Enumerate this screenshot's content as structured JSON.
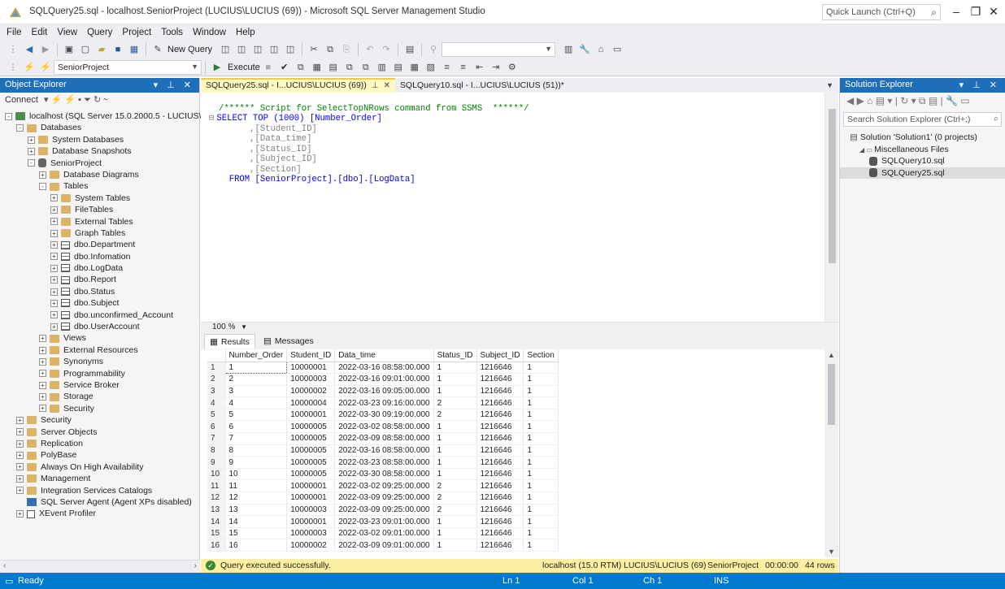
{
  "window": {
    "title": "SQLQuery25.sql - localhost.SeniorProject (LUCIUS\\LUCIUS (69)) - Microsoft SQL Server Management Studio",
    "quick_launch_placeholder": "Quick Launch (Ctrl+Q)"
  },
  "menu": [
    "File",
    "Edit",
    "View",
    "Query",
    "Project",
    "Tools",
    "Window",
    "Help"
  ],
  "toolbar": {
    "new_query": "New Query",
    "database": "SeniorProject",
    "execute": "Execute"
  },
  "object_explorer": {
    "title": "Object Explorer",
    "connect": "Connect",
    "tree": [
      {
        "label": "localhost (SQL Server 15.0.2000.5 - LUCIUS\\LU",
        "level": 0,
        "icon": "server-icon",
        "exp": "-"
      },
      {
        "label": "Databases",
        "level": 1,
        "icon": "folder-icon",
        "exp": "-"
      },
      {
        "label": "System Databases",
        "level": 2,
        "icon": "folder-icon",
        "exp": "+"
      },
      {
        "label": "Database Snapshots",
        "level": 2,
        "icon": "folder-icon",
        "exp": "+"
      },
      {
        "label": "SeniorProject",
        "level": 2,
        "icon": "database-icon",
        "exp": "-"
      },
      {
        "label": "Database Diagrams",
        "level": 3,
        "icon": "folder-icon",
        "exp": "+"
      },
      {
        "label": "Tables",
        "level": 3,
        "icon": "folder-icon",
        "exp": "-"
      },
      {
        "label": "System Tables",
        "level": 4,
        "icon": "folder-icon",
        "exp": "+"
      },
      {
        "label": "FileTables",
        "level": 4,
        "icon": "folder-icon",
        "exp": "+"
      },
      {
        "label": "External Tables",
        "level": 4,
        "icon": "folder-icon",
        "exp": "+"
      },
      {
        "label": "Graph Tables",
        "level": 4,
        "icon": "folder-icon",
        "exp": "+"
      },
      {
        "label": "dbo.Department",
        "level": 4,
        "icon": "table-icon",
        "exp": "+"
      },
      {
        "label": "dbo.Infomation",
        "level": 4,
        "icon": "table-icon",
        "exp": "+"
      },
      {
        "label": "dbo.LogData",
        "level": 4,
        "icon": "table-icon",
        "exp": "+"
      },
      {
        "label": "dbo.Report",
        "level": 4,
        "icon": "table-icon",
        "exp": "+"
      },
      {
        "label": "dbo.Status",
        "level": 4,
        "icon": "table-icon",
        "exp": "+"
      },
      {
        "label": "dbo.Subject",
        "level": 4,
        "icon": "table-icon",
        "exp": "+"
      },
      {
        "label": "dbo.unconfirmed_Account",
        "level": 4,
        "icon": "table-icon",
        "exp": "+"
      },
      {
        "label": "dbo.UserAccount",
        "level": 4,
        "icon": "table-icon",
        "exp": "+"
      },
      {
        "label": "Views",
        "level": 3,
        "icon": "folder-icon",
        "exp": "+"
      },
      {
        "label": "External Resources",
        "level": 3,
        "icon": "folder-icon",
        "exp": "+"
      },
      {
        "label": "Synonyms",
        "level": 3,
        "icon": "folder-icon",
        "exp": "+"
      },
      {
        "label": "Programmability",
        "level": 3,
        "icon": "folder-icon",
        "exp": "+"
      },
      {
        "label": "Service Broker",
        "level": 3,
        "icon": "folder-icon",
        "exp": "+"
      },
      {
        "label": "Storage",
        "level": 3,
        "icon": "folder-icon",
        "exp": "+"
      },
      {
        "label": "Security",
        "level": 3,
        "icon": "folder-icon",
        "exp": "+"
      },
      {
        "label": "Security",
        "level": 1,
        "icon": "folder-icon",
        "exp": "+"
      },
      {
        "label": "Server Objects",
        "level": 1,
        "icon": "folder-icon",
        "exp": "+"
      },
      {
        "label": "Replication",
        "level": 1,
        "icon": "folder-icon",
        "exp": "+"
      },
      {
        "label": "PolyBase",
        "level": 1,
        "icon": "folder-icon",
        "exp": "+"
      },
      {
        "label": "Always On High Availability",
        "level": 1,
        "icon": "folder-icon",
        "exp": "+"
      },
      {
        "label": "Management",
        "level": 1,
        "icon": "folder-icon",
        "exp": "+"
      },
      {
        "label": "Integration Services Catalogs",
        "level": 1,
        "icon": "folder-icon",
        "exp": "+"
      },
      {
        "label": "SQL Server Agent (Agent XPs disabled)",
        "level": 1,
        "icon": "agent-icon",
        "exp": ""
      },
      {
        "label": "XEvent Profiler",
        "level": 1,
        "icon": "xevent-icon",
        "exp": "+"
      }
    ]
  },
  "tabs": [
    {
      "label": "SQLQuery25.sql - I...UCIUS\\LUCIUS (69))",
      "active": true
    },
    {
      "label": "SQLQuery10.sql - I...UCIUS\\LUCIUS (51))*",
      "active": false
    }
  ],
  "editor": {
    "zoom": "100 %",
    "lines": [
      "/****** Script for SelectTopNRows command from SSMS  ******/",
      "SELECT TOP (1000) [Number_Order]",
      "      ,[Student_ID]",
      "      ,[Data_time]",
      "      ,[Status_ID]",
      "      ,[Subject_ID]",
      "      ,[Section]",
      "  FROM [SeniorProject].[dbo].[LogData]"
    ]
  },
  "results": {
    "tab_results": "Results",
    "tab_messages": "Messages",
    "columns": [
      "Number_Order",
      "Student_ID",
      "Data_time",
      "Status_ID",
      "Subject_ID",
      "Section"
    ],
    "rows": [
      [
        "1",
        "10000001",
        "2022-03-16 08:58:00.000",
        "1",
        "1216646",
        "1"
      ],
      [
        "2",
        "10000003",
        "2022-03-16 09:01:00.000",
        "1",
        "1216646",
        "1"
      ],
      [
        "3",
        "10000002",
        "2022-03-16 09:05:00.000",
        "1",
        "1216646",
        "1"
      ],
      [
        "4",
        "10000004",
        "2022-03-23 09:16:00.000",
        "2",
        "1216646",
        "1"
      ],
      [
        "5",
        "10000001",
        "2022-03-30 09:19:00.000",
        "2",
        "1216646",
        "1"
      ],
      [
        "6",
        "10000005",
        "2022-03-02 08:58:00.000",
        "1",
        "1216646",
        "1"
      ],
      [
        "7",
        "10000005",
        "2022-03-09 08:58:00.000",
        "1",
        "1216646",
        "1"
      ],
      [
        "8",
        "10000005",
        "2022-03-16 08:58:00.000",
        "1",
        "1216646",
        "1"
      ],
      [
        "9",
        "10000005",
        "2022-03-23 08:58:00.000",
        "1",
        "1216646",
        "1"
      ],
      [
        "10",
        "10000005",
        "2022-03-30 08:58:00.000",
        "1",
        "1216646",
        "1"
      ],
      [
        "11",
        "10000001",
        "2022-03-02 09:25:00.000",
        "2",
        "1216646",
        "1"
      ],
      [
        "12",
        "10000001",
        "2022-03-09 09:25:00.000",
        "2",
        "1216646",
        "1"
      ],
      [
        "13",
        "10000003",
        "2022-03-09 09:25:00.000",
        "2",
        "1216646",
        "1"
      ],
      [
        "14",
        "10000001",
        "2022-03-23 09:01:00.000",
        "1",
        "1216646",
        "1"
      ],
      [
        "15",
        "10000003",
        "2022-03-02 09:01:00.000",
        "1",
        "1216646",
        "1"
      ],
      [
        "16",
        "10000002",
        "2022-03-09 09:01:00.000",
        "1",
        "1216646",
        "1"
      ]
    ]
  },
  "query_status": {
    "message": "Query executed successfully.",
    "server": "localhost (15.0 RTM)",
    "user": "LUCIUS\\LUCIUS (69)",
    "database": "SeniorProject",
    "elapsed": "00:00:00",
    "rows": "44 rows"
  },
  "solution_explorer": {
    "title": "Solution Explorer",
    "search_placeholder": "Search Solution Explorer (Ctrl+;)",
    "items": [
      {
        "label": "Solution 'Solution1' (0 projects)",
        "level": 0,
        "selected": false
      },
      {
        "label": "Miscellaneous Files",
        "level": 1,
        "selected": false
      },
      {
        "label": "SQLQuery10.sql",
        "level": 2,
        "selected": false
      },
      {
        "label": "SQLQuery25.sql",
        "level": 2,
        "selected": true
      }
    ]
  },
  "statusbar": {
    "ready": "Ready",
    "ln": "Ln 1",
    "col": "Col 1",
    "ch": "Ch 1",
    "ins": "INS"
  },
  "colors": {
    "accent": "#007acc",
    "panel_header": "#1f6fb8",
    "query_status_bg": "#fcefa1",
    "active_tab": "#fff9c4"
  }
}
